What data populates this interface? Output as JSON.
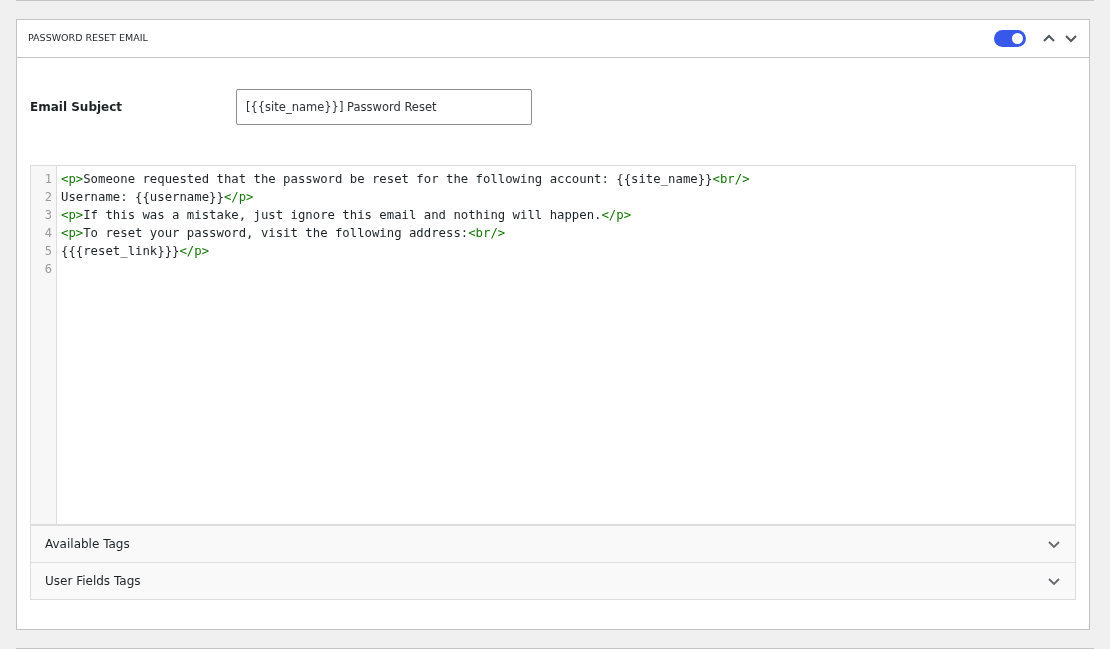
{
  "panel": {
    "title": "PASSWORD RESET EMAIL",
    "enabled": true
  },
  "subject": {
    "label": "Email Subject",
    "value": "[{{site_name}}] Password Reset"
  },
  "editor": {
    "lines": [
      {
        "number": "1",
        "segments": [
          {
            "kind": "tag",
            "text": "<p>"
          },
          {
            "kind": "text",
            "text": "Someone requested that the password be reset for the following account: {{site_name}}"
          },
          {
            "kind": "tag",
            "text": "<br/>"
          }
        ]
      },
      {
        "number": "2",
        "segments": [
          {
            "kind": "text",
            "text": "Username: {{username}}"
          },
          {
            "kind": "tag",
            "text": "</p>"
          }
        ]
      },
      {
        "number": "3",
        "segments": [
          {
            "kind": "tag",
            "text": "<p>"
          },
          {
            "kind": "text",
            "text": "If this was a mistake, just ignore this email and nothing will happen."
          },
          {
            "kind": "tag",
            "text": "</p>"
          }
        ]
      },
      {
        "number": "4",
        "segments": [
          {
            "kind": "tag",
            "text": "<p>"
          },
          {
            "kind": "text",
            "text": "To reset your password, visit the following address:"
          },
          {
            "kind": "tag",
            "text": "<br/>"
          }
        ]
      },
      {
        "number": "5",
        "segments": [
          {
            "kind": "text",
            "text": "{{{reset_link}}}"
          },
          {
            "kind": "tag",
            "text": "</p>"
          }
        ]
      },
      {
        "number": "6"
      }
    ]
  },
  "sections": [
    {
      "label": "Available Tags",
      "expanded": false
    },
    {
      "label": "User Fields Tags",
      "expanded": false
    }
  ]
}
